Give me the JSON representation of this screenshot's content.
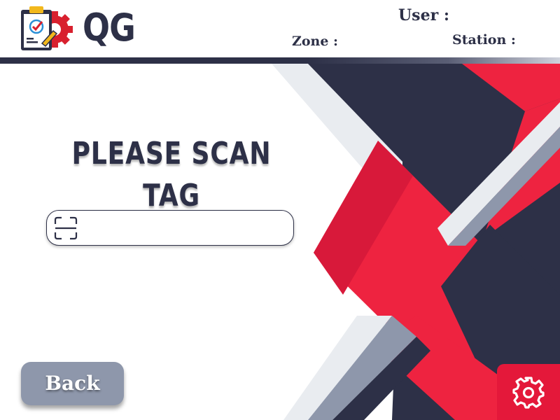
{
  "header": {
    "brand": "QG",
    "logo_icon": "clipboard-gear-icon",
    "user_label": "User :",
    "zone_label": "Zone :",
    "station_label": "Station :"
  },
  "main": {
    "title": "PLEASE SCAN TAG",
    "scan_input": {
      "value": "",
      "placeholder": "",
      "icon": "scan-frame-icon"
    }
  },
  "footer": {
    "back_label": "Back",
    "settings_icon": "gear-icon"
  },
  "colors": {
    "navy": "#2d3047",
    "red": "#ee2340",
    "slate": "#8e97ab",
    "light_gray": "#e9ecf0"
  }
}
